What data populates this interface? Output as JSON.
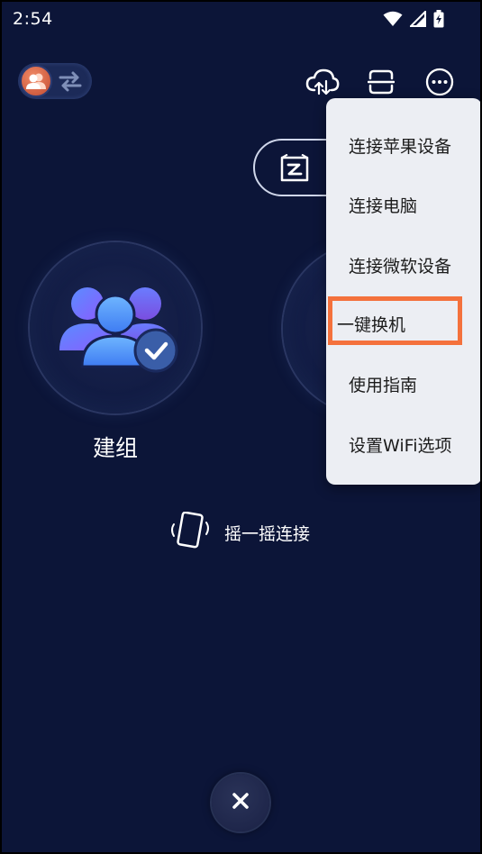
{
  "status": {
    "time": "2:54"
  },
  "toolbar": {
    "toggle_icon": "group-icon",
    "swap_icon": "swap-icon",
    "cloud_icon": "cloud-upload-icon",
    "scan_icon": "scan-icon",
    "more_icon": "more-icon"
  },
  "main": {
    "group_label": "建组",
    "shake_label": "摇一摇连接"
  },
  "menu": {
    "items": [
      {
        "label": "连接苹果设备"
      },
      {
        "label": "连接电脑"
      },
      {
        "label": "连接微软设备"
      },
      {
        "label": "一键换机"
      },
      {
        "label": "使用指南"
      },
      {
        "label": "设置WiFi选项"
      }
    ]
  },
  "colors": {
    "background": "#0c1538",
    "menu_bg": "#eceef3",
    "highlight": "#f4713c",
    "group_icon_gradient_start": "#5a8cff",
    "group_icon_gradient_end": "#8a5cff"
  }
}
